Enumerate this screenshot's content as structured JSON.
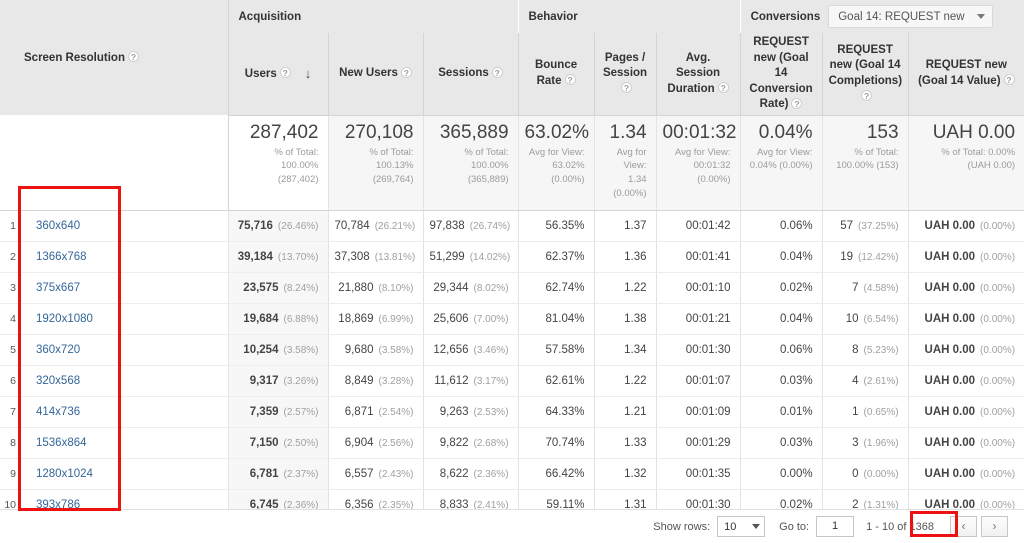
{
  "report": {
    "dimension_header": "Screen Resolution",
    "help_icon": "question-mark-icon",
    "sort_arrow": "↓",
    "groups": {
      "acquisition": "Acquisition",
      "behavior": "Behavior",
      "conversions": "Conversions"
    },
    "conversions_select": {
      "value": "Goal 14: REQUEST new",
      "caret_icon": "chevron-down-icon"
    },
    "columns": [
      {
        "label": "Users",
        "sorted": true
      },
      {
        "label": "New Users",
        "sorted": false
      },
      {
        "label": "Sessions",
        "sorted": false
      },
      {
        "label": "Bounce Rate",
        "sorted": false
      },
      {
        "label": "Pages / Session",
        "sorted": false
      },
      {
        "label": "Avg. Session Duration",
        "sorted": false
      },
      {
        "label": "REQUEST new (Goal 14 Conversion Rate)",
        "sorted": false
      },
      {
        "label": "REQUEST new (Goal 14 Completions)",
        "sorted": false
      },
      {
        "label": "REQUEST new (Goal 14 Value)",
        "sorted": false
      }
    ],
    "totals": [
      {
        "value": "287,402",
        "lines": [
          "% of Total:",
          "100.00%",
          "(287,402)"
        ]
      },
      {
        "value": "270,108",
        "lines": [
          "% of Total:",
          "100.13%",
          "(269,764)"
        ]
      },
      {
        "value": "365,889",
        "lines": [
          "% of Total:",
          "100.00%",
          "(365,889)"
        ]
      },
      {
        "value": "63.02%",
        "lines": [
          "Avg for View:",
          "63.02%",
          "(0.00%)"
        ]
      },
      {
        "value": "1.34",
        "lines": [
          "Avg for View:",
          "1.34",
          "(0.00%)"
        ]
      },
      {
        "value": "00:01:32",
        "lines": [
          "Avg for View:",
          "00:01:32",
          "(0.00%)"
        ]
      },
      {
        "value": "0.04%",
        "lines": [
          "Avg for View:",
          "0.04% (0.00%)"
        ]
      },
      {
        "value": "153",
        "lines": [
          "% of Total:",
          "100.00% (153)"
        ]
      },
      {
        "value": "UAH 0.00",
        "lines": [
          "% of Total: 0.00%",
          "(UAH 0.00)"
        ]
      }
    ],
    "rows": [
      {
        "index": "1",
        "resolution": "360x640",
        "users": "75,716",
        "users_pct": "(26.46%)",
        "new_users": "70,784",
        "new_users_pct": "(26.21%)",
        "sessions": "97,838",
        "sessions_pct": "(26.74%)",
        "bounce_rate": "56.35%",
        "pages_session": "1.37",
        "avg_duration": "00:01:42",
        "goal_rate": "0.06%",
        "goal_completions": "57",
        "goal_completions_pct": "(37.25%)",
        "goal_value": "UAH 0.00",
        "goal_value_pct": "(0.00%)"
      },
      {
        "index": "2",
        "resolution": "1366x768",
        "users": "39,184",
        "users_pct": "(13.70%)",
        "new_users": "37,308",
        "new_users_pct": "(13.81%)",
        "sessions": "51,299",
        "sessions_pct": "(14.02%)",
        "bounce_rate": "62.37%",
        "pages_session": "1.36",
        "avg_duration": "00:01:41",
        "goal_rate": "0.04%",
        "goal_completions": "19",
        "goal_completions_pct": "(12.42%)",
        "goal_value": "UAH 0.00",
        "goal_value_pct": "(0.00%)"
      },
      {
        "index": "3",
        "resolution": "375x667",
        "users": "23,575",
        "users_pct": "(8.24%)",
        "new_users": "21,880",
        "new_users_pct": "(8.10%)",
        "sessions": "29,344",
        "sessions_pct": "(8.02%)",
        "bounce_rate": "62.74%",
        "pages_session": "1.22",
        "avg_duration": "00:01:10",
        "goal_rate": "0.02%",
        "goal_completions": "7",
        "goal_completions_pct": "(4.58%)",
        "goal_value": "UAH 0.00",
        "goal_value_pct": "(0.00%)"
      },
      {
        "index": "4",
        "resolution": "1920x1080",
        "users": "19,684",
        "users_pct": "(6.88%)",
        "new_users": "18,869",
        "new_users_pct": "(6.99%)",
        "sessions": "25,606",
        "sessions_pct": "(7.00%)",
        "bounce_rate": "81.04%",
        "pages_session": "1.38",
        "avg_duration": "00:01:21",
        "goal_rate": "0.04%",
        "goal_completions": "10",
        "goal_completions_pct": "(6.54%)",
        "goal_value": "UAH 0.00",
        "goal_value_pct": "(0.00%)"
      },
      {
        "index": "5",
        "resolution": "360x720",
        "users": "10,254",
        "users_pct": "(3.58%)",
        "new_users": "9,680",
        "new_users_pct": "(3.58%)",
        "sessions": "12,656",
        "sessions_pct": "(3.46%)",
        "bounce_rate": "57.58%",
        "pages_session": "1.34",
        "avg_duration": "00:01:30",
        "goal_rate": "0.06%",
        "goal_completions": "8",
        "goal_completions_pct": "(5.23%)",
        "goal_value": "UAH 0.00",
        "goal_value_pct": "(0.00%)"
      },
      {
        "index": "6",
        "resolution": "320x568",
        "users": "9,317",
        "users_pct": "(3.26%)",
        "new_users": "8,849",
        "new_users_pct": "(3.28%)",
        "sessions": "11,612",
        "sessions_pct": "(3.17%)",
        "bounce_rate": "62.61%",
        "pages_session": "1.22",
        "avg_duration": "00:01:07",
        "goal_rate": "0.03%",
        "goal_completions": "4",
        "goal_completions_pct": "(2.61%)",
        "goal_value": "UAH 0.00",
        "goal_value_pct": "(0.00%)"
      },
      {
        "index": "7",
        "resolution": "414x736",
        "users": "7,359",
        "users_pct": "(2.57%)",
        "new_users": "6,871",
        "new_users_pct": "(2.54%)",
        "sessions": "9,263",
        "sessions_pct": "(2.53%)",
        "bounce_rate": "64.33%",
        "pages_session": "1.21",
        "avg_duration": "00:01:09",
        "goal_rate": "0.01%",
        "goal_completions": "1",
        "goal_completions_pct": "(0.65%)",
        "goal_value": "UAH 0.00",
        "goal_value_pct": "(0.00%)"
      },
      {
        "index": "8",
        "resolution": "1536x864",
        "users": "7,150",
        "users_pct": "(2.50%)",
        "new_users": "6,904",
        "new_users_pct": "(2.56%)",
        "sessions": "9,822",
        "sessions_pct": "(2.68%)",
        "bounce_rate": "70.74%",
        "pages_session": "1.33",
        "avg_duration": "00:01:29",
        "goal_rate": "0.03%",
        "goal_completions": "3",
        "goal_completions_pct": "(1.96%)",
        "goal_value": "UAH 0.00",
        "goal_value_pct": "(0.00%)"
      },
      {
        "index": "9",
        "resolution": "1280x1024",
        "users": "6,781",
        "users_pct": "(2.37%)",
        "new_users": "6,557",
        "new_users_pct": "(2.43%)",
        "sessions": "8,622",
        "sessions_pct": "(2.36%)",
        "bounce_rate": "66.42%",
        "pages_session": "1.32",
        "avg_duration": "00:01:35",
        "goal_rate": "0.00%",
        "goal_completions": "0",
        "goal_completions_pct": "(0.00%)",
        "goal_value": "UAH 0.00",
        "goal_value_pct": "(0.00%)"
      },
      {
        "index": "10",
        "resolution": "393x786",
        "users": "6,745",
        "users_pct": "(2.36%)",
        "new_users": "6,356",
        "new_users_pct": "(2.35%)",
        "sessions": "8,833",
        "sessions_pct": "(2.41%)",
        "bounce_rate": "59.11%",
        "pages_session": "1.31",
        "avg_duration": "00:01:30",
        "goal_rate": "0.02%",
        "goal_completions": "2",
        "goal_completions_pct": "(1.31%)",
        "goal_value": "UAH 0.00",
        "goal_value_pct": "(0.00%)"
      }
    ],
    "footer": {
      "show_rows_label": "Show rows:",
      "show_rows_value": "10",
      "go_to_label": "Go to:",
      "go_to_value": "1",
      "range_text": "1 - 10 of 1368",
      "prev_icon": "‹",
      "next_icon": "›"
    },
    "annotations": {
      "accent_color": "#ee1111",
      "link_color": "#336699",
      "header_bg": "#e8e8e8"
    }
  }
}
